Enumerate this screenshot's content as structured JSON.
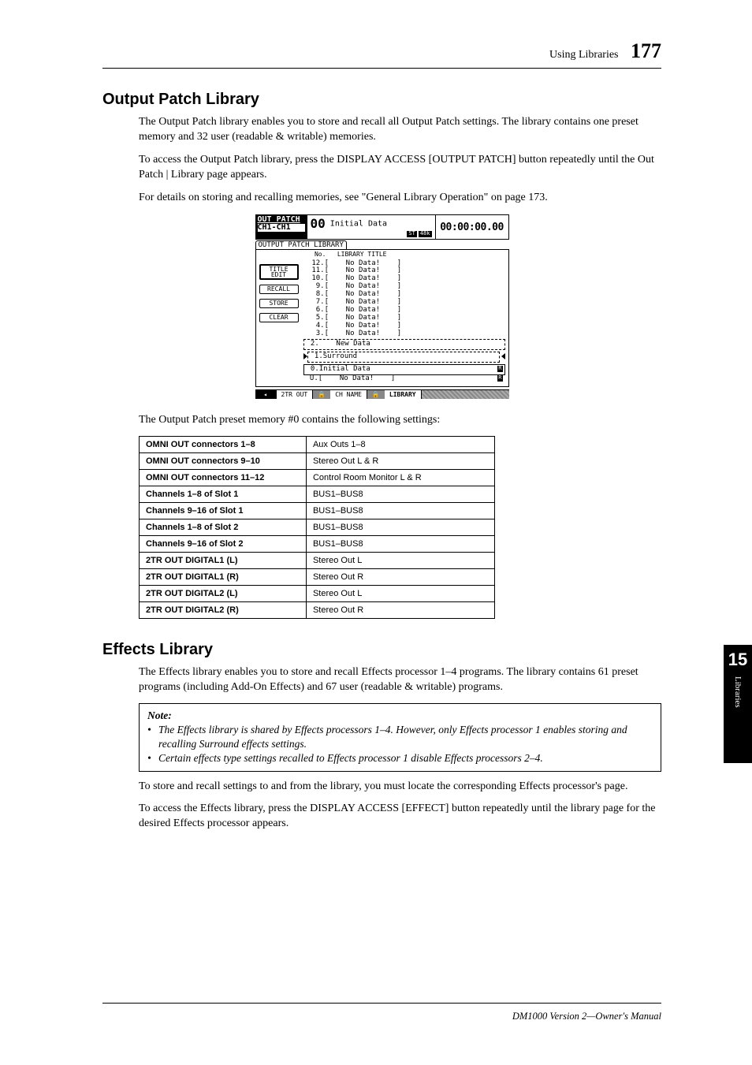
{
  "header": {
    "section": "Using Libraries",
    "page_number": "177"
  },
  "h1": "Output Patch Library",
  "p1": "The Output Patch library enables you to store and recall all Output Patch settings. The library contains one preset memory and 32 user (readable & writable) memories.",
  "p2": "To access the Output Patch library, press the DISPLAY ACCESS [OUTPUT PATCH] button repeatedly until the Out Patch | Library page appears.",
  "p3": "For details on storing and recalling memories, see \"General Library Operation\" on page 173.",
  "screenshot": {
    "top_left_line1": "OUT PATCH",
    "top_left_line2": "CH1-CH1",
    "level": "00",
    "title": "Initial Data",
    "badge1": "ST",
    "badge2": "48k",
    "timecode": "00:00:00.00",
    "tab": "OUTPUT PATCH LIBRARY",
    "list_hdr_no": "No.",
    "list_hdr_title": "LIBRARY TITLE",
    "btn_title": "TITLE\nEDIT",
    "btn_recall": "RECALL",
    "btn_store": "STORE",
    "btn_clear": "CLEAR",
    "rows": [
      "12.[    No Data!    ]",
      "11.[    No Data!    ]",
      "10.[    No Data!    ]",
      " 9.[    No Data!    ]",
      " 8.[    No Data!    ]",
      " 7.[    No Data!    ]",
      " 6.[    No Data!    ]",
      " 5.[    No Data!    ]",
      " 4.[    No Data!    ]",
      " 3.[    No Data!    ]"
    ],
    "row_new": " 2.    New Data",
    "row_sel": " 1.Surround",
    "row_init": " 0.Initial Data",
    "row_u": " U.[    No Data!    ]",
    "ro": "R",
    "bt_arrow": "◂",
    "bt1": "2TR OUT",
    "bt2": "CH NAME",
    "bt3": "LIBRARY",
    "lock": "🔒"
  },
  "p4": "The Output Patch preset memory #0 contains the following settings:",
  "table": [
    [
      "OMNI OUT connectors 1–8",
      "Aux Outs 1–8"
    ],
    [
      "OMNI OUT connectors 9–10",
      "Stereo Out L & R"
    ],
    [
      "OMNI OUT connectors 11–12",
      "Control Room Monitor L & R"
    ],
    [
      "Channels 1–8 of Slot 1",
      "BUS1–BUS8"
    ],
    [
      "Channels 9–16 of Slot 1",
      "BUS1–BUS8"
    ],
    [
      "Channels 1–8 of Slot 2",
      "BUS1–BUS8"
    ],
    [
      "Channels 9–16 of Slot 2",
      "BUS1–BUS8"
    ],
    [
      "2TR OUT DIGITAL1 (L)",
      "Stereo Out L"
    ],
    [
      "2TR OUT DIGITAL1 (R)",
      "Stereo Out R"
    ],
    [
      "2TR OUT DIGITAL2 (L)",
      "Stereo Out L"
    ],
    [
      "2TR OUT DIGITAL2 (R)",
      "Stereo Out R"
    ]
  ],
  "h2": "Effects Library",
  "p5": "The Effects library enables you to store and recall Effects processor 1–4 programs. The library contains 61 preset programs (including Add-On Effects) and 67 user (readable & writable) programs.",
  "note": {
    "title": "Note:",
    "li1": "The Effects library is shared by Effects processors 1–4. However, only Effects processor 1 enables storing and recalling Surround effects settings.",
    "li2": "Certain effects type settings recalled to Effects processor 1 disable Effects processors 2–4."
  },
  "p6": "To store and recall settings to and from the library, you must locate the corresponding Effects processor's page.",
  "p7": "To access the Effects library, press the DISPLAY ACCESS [EFFECT] button repeatedly until the library page for the desired Effects processor appears.",
  "side": {
    "chapter": "15",
    "label": "Libraries"
  },
  "footer": "DM1000 Version 2—Owner's Manual"
}
